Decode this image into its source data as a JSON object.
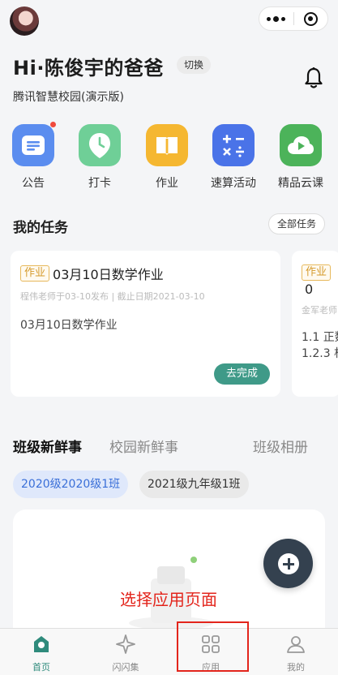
{
  "header": {
    "greeting": "Hi·陈俊宇的爸爸",
    "switch_label": "切换",
    "school": "腾讯智慧校园(演示版)"
  },
  "apps": [
    {
      "label": "公告",
      "icon": "announcement-icon",
      "color": "#5b8def",
      "badge": true
    },
    {
      "label": "打卡",
      "icon": "check-in-icon",
      "color": "#6fcf97",
      "badge": false
    },
    {
      "label": "作业",
      "icon": "homework-book-icon",
      "color": "#f5b731",
      "badge": false
    },
    {
      "label": "速算活动",
      "icon": "calculator-icon",
      "color": "#4a73e8",
      "badge": false
    },
    {
      "label": "精品云课",
      "icon": "cloud-play-icon",
      "color": "#4cb35a",
      "badge": false
    }
  ],
  "tasks": {
    "title": "我的任务",
    "all_label": "全部任务",
    "cards": [
      {
        "tag": "作业",
        "title": "03月10日数学作业",
        "meta": "程伟老师于03-10发布 | 截止日期2021-03-10",
        "body": [
          "03月10日数学作业"
        ],
        "action": "去完成"
      },
      {
        "tag": "作业",
        "title": "0",
        "meta": "金军老师",
        "body": [
          "1.1 正数",
          "1.2.3 相"
        ]
      }
    ]
  },
  "news_tabs": [
    {
      "label": "班级新鲜事",
      "active": true
    },
    {
      "label": "校园新鲜事",
      "active": false
    },
    {
      "label": "班级相册",
      "active": false
    }
  ],
  "class_chips": [
    "2020级2020级1班",
    "2021级九年级1班"
  ],
  "annotation": {
    "text": "选择应用页面",
    "color": "#e3251c"
  },
  "tabbar": [
    {
      "label": "首页",
      "icon": "home-icon",
      "active": true
    },
    {
      "label": "闪闪集",
      "icon": "sparkle-icon",
      "active": false
    },
    {
      "label": "应用",
      "icon": "apps-grid-icon",
      "active": false
    },
    {
      "label": "我的",
      "icon": "profile-icon",
      "active": false
    }
  ],
  "colors": {
    "accent": "#2f8b7c",
    "done_button": "#3f9a88",
    "fab": "#34414f"
  }
}
